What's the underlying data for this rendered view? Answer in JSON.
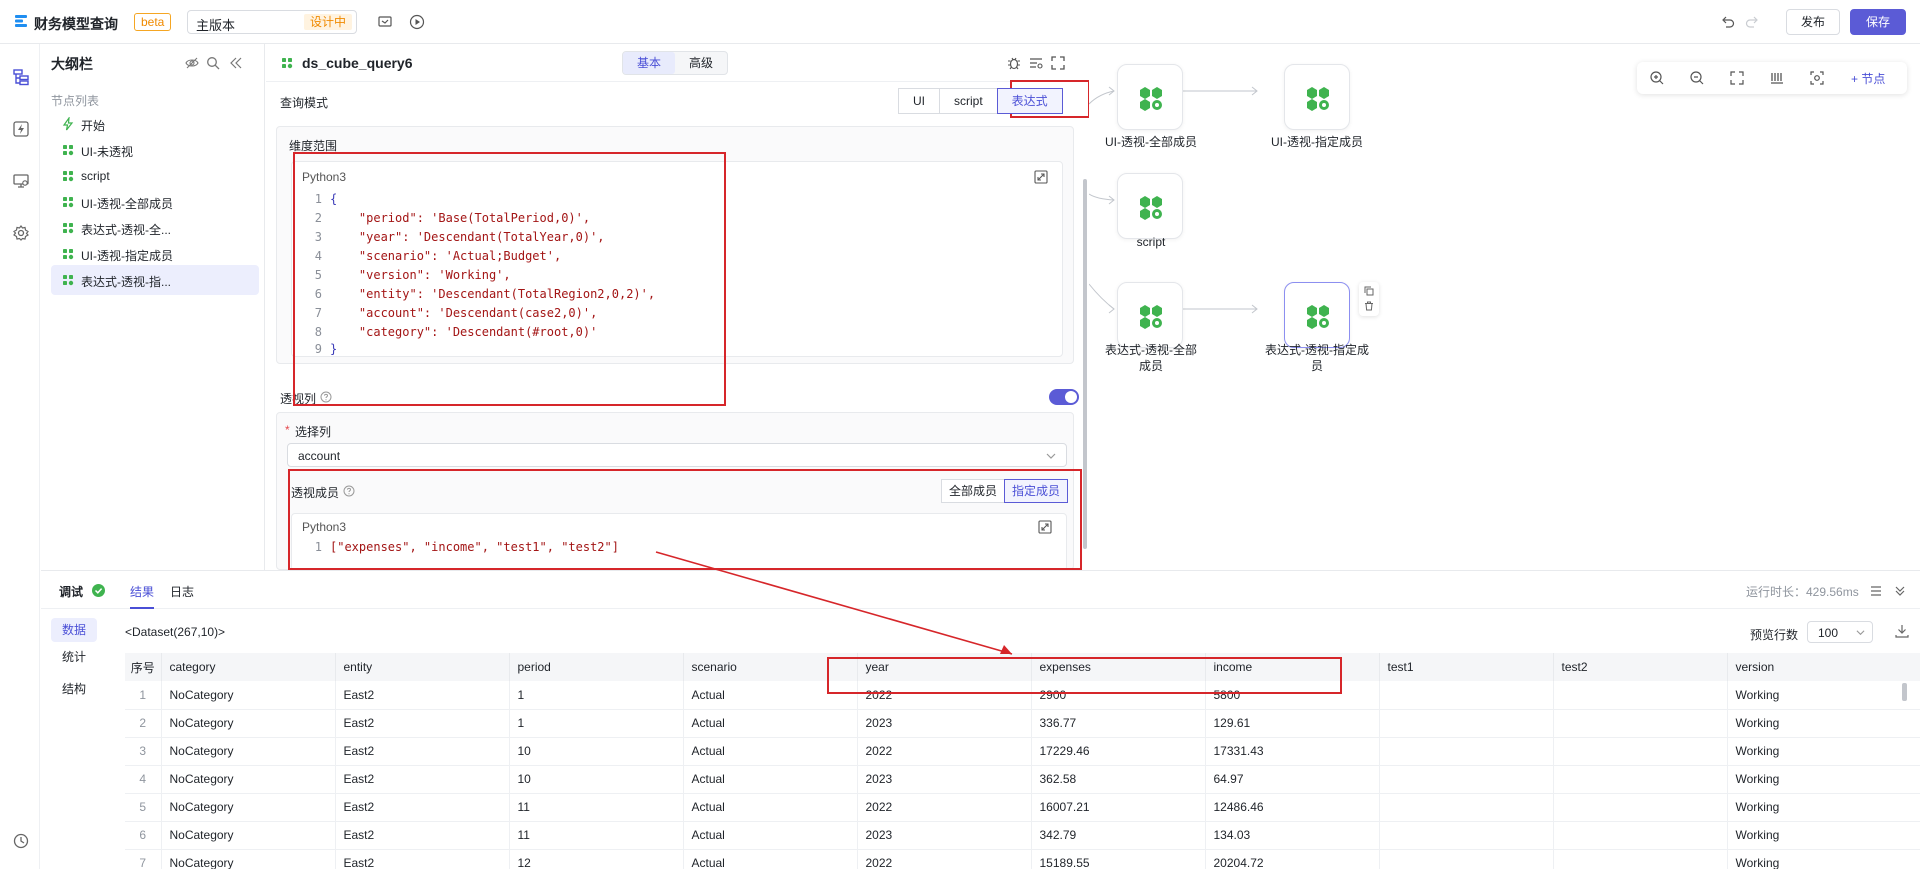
{
  "topbar": {
    "app_title": "财务模型查询",
    "beta_badge": "beta",
    "version_label": "主版本",
    "version_state": "设计中",
    "publish_label": "发布",
    "save_label": "保存"
  },
  "outline": {
    "title": "大纲栏",
    "section_label": "节点列表",
    "items": [
      {
        "label": "开始",
        "icon": "lightning-icon"
      },
      {
        "label": "UI-未透视",
        "icon": "cube-node-icon"
      },
      {
        "label": "script",
        "icon": "cube-node-icon"
      },
      {
        "label": "UI-透视-全部成员",
        "icon": "cube-node-icon"
      },
      {
        "label": "表达式-透视-全...",
        "icon": "cube-node-icon"
      },
      {
        "label": "UI-透视-指定成员",
        "icon": "cube-node-icon"
      },
      {
        "label": "表达式-透视-指...",
        "icon": "cube-node-icon",
        "active": true
      }
    ]
  },
  "props": {
    "node_name": "ds_cube_query6",
    "tabs": [
      "基本",
      "高级"
    ],
    "active_tab": "基本",
    "query_mode_label": "查询模式",
    "query_modes": [
      "UI",
      "script",
      "表达式"
    ],
    "active_mode": "表达式",
    "dimension_scope_label": "维度范围",
    "editor_lang": "Python3",
    "dimension_code": [
      "{",
      "    \"period\": 'Base(TotalPeriod,0)',",
      "    \"year\": 'Descendant(TotalYear,0)',",
      "    \"scenario\": 'Actual;Budget',",
      "    \"version\": 'Working',",
      "    \"entity\": 'Descendant(TotalRegion2,0,2)',",
      "    \"account\": 'Descendant(case2,0)',",
      "    \"category\": 'Descendant(#root,0)'",
      "}"
    ],
    "pivot_col_label": "透视列",
    "select_col_label": "选择列",
    "required_mark": "*",
    "select_col_value": "account",
    "pivot_members_label": "透视成员",
    "member_modes": [
      "全部成员",
      "指定成员"
    ],
    "active_member_mode": "指定成员",
    "members_lang": "Python3",
    "members_code": "[\"expenses\", \"income\", \"test1\", \"test2\"]"
  },
  "canvas": {
    "add_node_label": "+ 节点",
    "nodes": [
      {
        "label": "UI-透视-全部成员"
      },
      {
        "label": "UI-透视-指定成员"
      },
      {
        "label": "script"
      },
      {
        "label": "表达式-透视-全部成员"
      },
      {
        "label": "表达式-透视-指定成员"
      }
    ]
  },
  "debug": {
    "title": "调试",
    "tabs": [
      "结果",
      "日志"
    ],
    "active_tab": "结果",
    "runtime": "运行时长：429.56ms",
    "side_tabs": [
      "数据",
      "统计",
      "结构"
    ],
    "active_side": "数据",
    "dataset_info": "<Dataset(267,10)>",
    "preview_rows_label": "预览行数",
    "preview_rows_value": "100",
    "columns": [
      "序号",
      "category",
      "entity",
      "period",
      "scenario",
      "year",
      "expenses",
      "income",
      "test1",
      "test2",
      "version"
    ],
    "rows": [
      [
        "1",
        "NoCategory",
        "East2",
        "1",
        "Actual",
        "2022",
        "2900",
        "5800",
        "",
        "",
        "Working"
      ],
      [
        "2",
        "NoCategory",
        "East2",
        "1",
        "Actual",
        "2023",
        "336.77",
        "129.61",
        "",
        "",
        "Working"
      ],
      [
        "3",
        "NoCategory",
        "East2",
        "10",
        "Actual",
        "2022",
        "17229.46",
        "17331.43",
        "",
        "",
        "Working"
      ],
      [
        "4",
        "NoCategory",
        "East2",
        "10",
        "Actual",
        "2023",
        "362.58",
        "64.97",
        "",
        "",
        "Working"
      ],
      [
        "5",
        "NoCategory",
        "East2",
        "11",
        "Actual",
        "2022",
        "16007.21",
        "12486.46",
        "",
        "",
        "Working"
      ],
      [
        "6",
        "NoCategory",
        "East2",
        "11",
        "Actual",
        "2023",
        "342.79",
        "134.03",
        "",
        "",
        "Working"
      ],
      [
        "7",
        "NoCategory",
        "East2",
        "12",
        "Actual",
        "2022",
        "15189.55",
        "20204.72",
        "",
        "",
        "Working"
      ]
    ]
  },
  "colors": {
    "accent": "#5b5bd6",
    "highlight_box": "#d6262a",
    "node_icon": "#3fb34f"
  }
}
